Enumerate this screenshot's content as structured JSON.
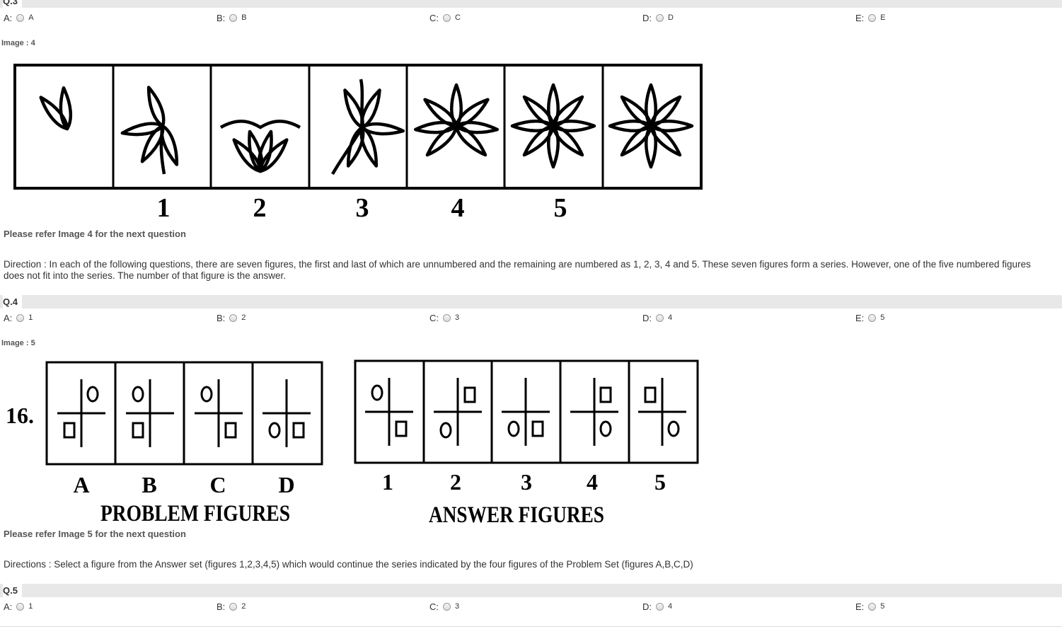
{
  "q3": {
    "label": "Q.3",
    "options": [
      {
        "letter": "A:",
        "value": "A"
      },
      {
        "letter": "B:",
        "value": "B"
      },
      {
        "letter": "C:",
        "value": "C"
      },
      {
        "letter": "D:",
        "value": "D"
      },
      {
        "letter": "E:",
        "value": "E"
      }
    ]
  },
  "image4": {
    "label": "Image : 4",
    "numbers": [
      "1",
      "2",
      "3",
      "4",
      "5"
    ],
    "refer": "Please refer Image 4 for the next question",
    "direction": "Direction : In each of the following questions, there are seven figures, the first and last of which are unnumbered and the remaining are numbered as 1, 2, 3, 4 and 5. These seven figures form a series. However, one of the five numbered figures does not fit into the series. The number of that figure is the answer."
  },
  "q4": {
    "label": "Q.4",
    "options": [
      {
        "letter": "A:",
        "value": "1"
      },
      {
        "letter": "B:",
        "value": "2"
      },
      {
        "letter": "C:",
        "value": "3"
      },
      {
        "letter": "D:",
        "value": "4"
      },
      {
        "letter": "E:",
        "value": "5"
      }
    ]
  },
  "image5": {
    "label": "Image : 5",
    "question_number": "16.",
    "problem_letters": [
      "A",
      "B",
      "C",
      "D"
    ],
    "answer_numbers": [
      "1",
      "2",
      "3",
      "4",
      "5"
    ],
    "problem_caption": "PROBLEM FIGURES",
    "answer_caption": "ANSWER FIGURES",
    "refer": "Please refer Image 5 for the next question",
    "direction": "Directions : Select a figure from the Answer set (figures 1,2,3,4,5) which would continue the series indicated by the four figures of the Problem Set (figures A,B,C,D)"
  },
  "q5": {
    "label": "Q.5",
    "options": [
      {
        "letter": "A:",
        "value": "1"
      },
      {
        "letter": "B:",
        "value": "2"
      },
      {
        "letter": "C:",
        "value": "3"
      },
      {
        "letter": "D:",
        "value": "4"
      },
      {
        "letter": "E:",
        "value": "5"
      }
    ]
  }
}
